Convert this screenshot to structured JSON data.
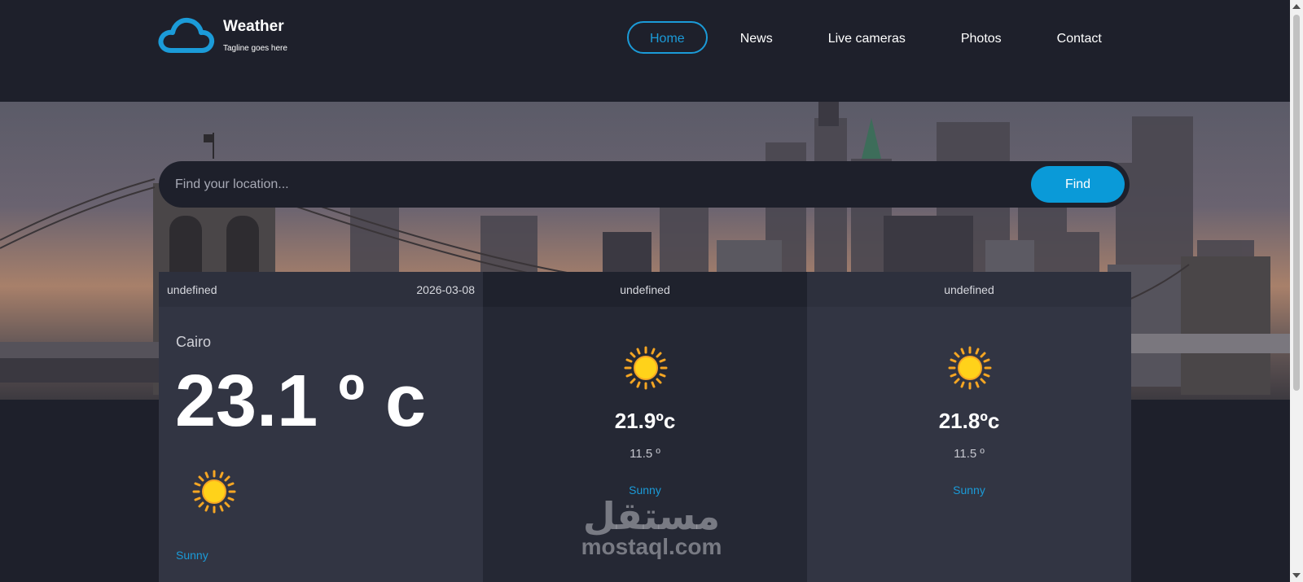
{
  "brand": {
    "title": "Weather",
    "tagline": "Tagline goes here",
    "logo_icon": "cloud-icon",
    "accent_color": "#1b9bd8"
  },
  "nav": {
    "items": [
      {
        "label": "Home",
        "active": true
      },
      {
        "label": "News",
        "active": false
      },
      {
        "label": "Live cameras",
        "active": false
      },
      {
        "label": "Photos",
        "active": false
      },
      {
        "label": "Contact",
        "active": false
      }
    ]
  },
  "search": {
    "placeholder": "Find your location...",
    "button_label": "Find"
  },
  "forecast": {
    "today": {
      "day": "undefined",
      "date": "2026-03-08",
      "city": "Cairo",
      "temp": "23.1 º c",
      "icon": "sun-icon",
      "condition": "Sunny"
    },
    "days": [
      {
        "day": "undefined",
        "max": "21.9ºc",
        "min": "11.5 º",
        "icon": "sun-icon",
        "condition": "Sunny"
      },
      {
        "day": "undefined",
        "max": "21.8ºc",
        "min": "11.5 º",
        "icon": "sun-icon",
        "condition": "Sunny"
      }
    ]
  },
  "watermark": {
    "arabic": "مستقل",
    "latin": "mostaql.com"
  }
}
